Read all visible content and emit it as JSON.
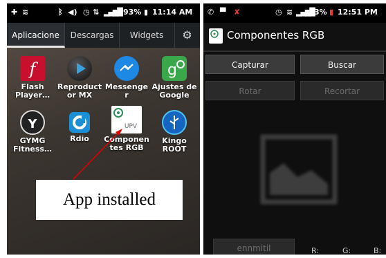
{
  "left": {
    "status": {
      "percent": "93%",
      "time": "11:14 AM"
    },
    "tabs": [
      {
        "label": "Aplicacione",
        "active": true
      },
      {
        "label": "Descargas",
        "active": false
      },
      {
        "label": "Widgets",
        "active": false
      }
    ],
    "apps": [
      {
        "label": "Flash Player…",
        "icon": "flash-icon"
      },
      {
        "label": "Reproduct or MX",
        "icon": "play-icon"
      },
      {
        "label": "Messenger",
        "icon": "messenger-icon"
      },
      {
        "label": "Ajustes de Google",
        "icon": "google-settings-icon"
      },
      {
        "label": "GYMG Fitness…",
        "icon": "gym-icon"
      },
      {
        "label": "Rdio",
        "icon": "rdio-icon"
      },
      {
        "label": "Componen tes RGB",
        "icon": "upv-icon"
      },
      {
        "label": "Kingo ROOT",
        "icon": "usb-icon"
      }
    ],
    "callout": "App installed"
  },
  "right": {
    "status": {
      "percent": "3%",
      "time": "12:51 PM"
    },
    "title": "Componentes RGB",
    "buttons": {
      "capture": "Capturar",
      "search": "Buscar",
      "rotate": "Rotar",
      "crop": "Recortar",
      "extra": "ennmitil"
    },
    "rgb": {
      "r": "R:",
      "g": "G:",
      "b": "B:"
    }
  },
  "colors": {
    "accent_blue": "#2aa7e0",
    "flash_red": "#c8102e",
    "google_green": "#3aa84a",
    "messenger_blue": "#1e88e5"
  }
}
